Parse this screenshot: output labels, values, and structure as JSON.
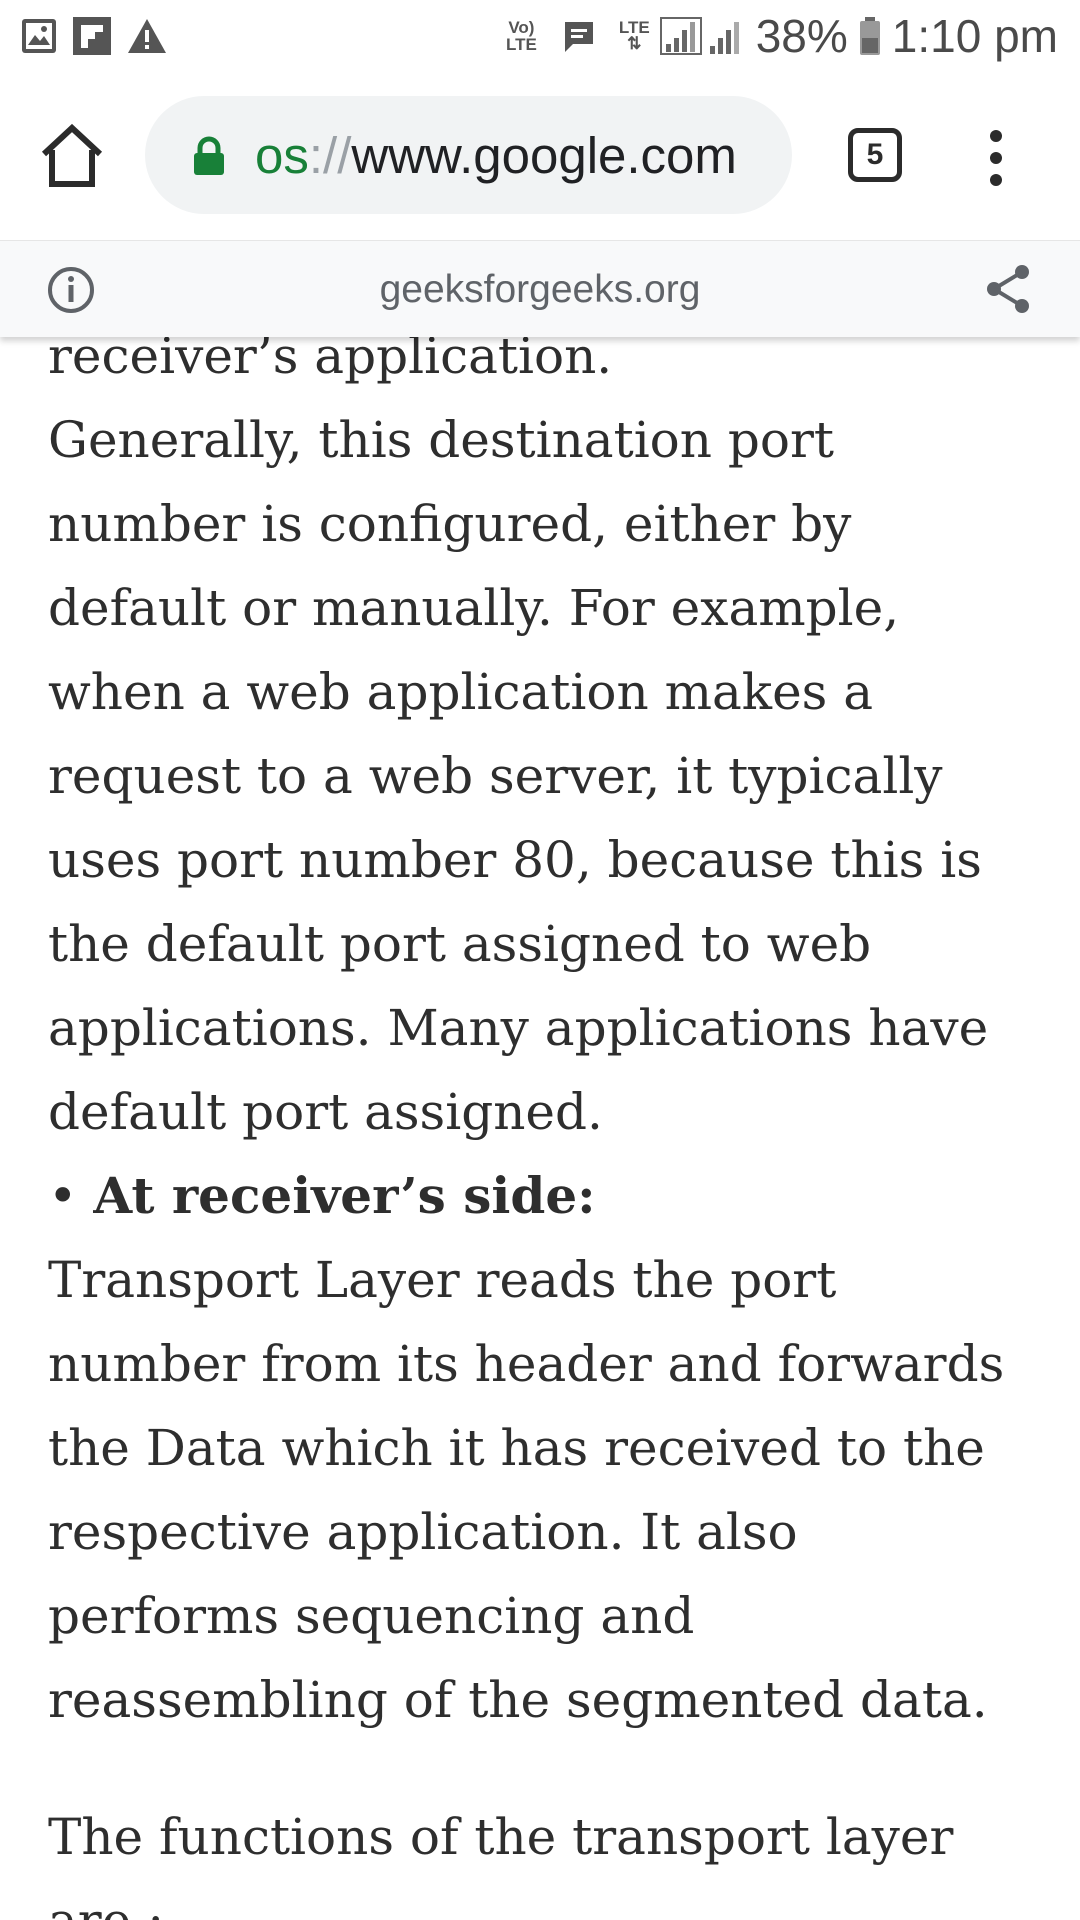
{
  "status_bar": {
    "volte_top": "Vo)",
    "volte_bottom": "LTE",
    "lte_label": "LTE",
    "battery_percent": "38%",
    "time": "1:10 pm",
    "icons": [
      "image-icon",
      "flipboard-icon",
      "warning-icon",
      "message-icon",
      "signal-icon",
      "battery-icon"
    ]
  },
  "browser": {
    "url_scheme_partial": "os",
    "url_separator": "://",
    "url_host": "www.google.com",
    "tab_count": "5",
    "info_domain": "geeksforgeeks.org"
  },
  "article": {
    "lines": [
      "receiver’s application.",
      "Generally, this destination port",
      "number is configured, either by",
      "default or manually. For example,",
      "when a web application makes a",
      "request to a web server, it typically",
      "uses port number 80, because this is",
      "the default port assigned to web",
      "applications. Many applications have",
      "default port assigned."
    ],
    "bullet": "•",
    "bullet_heading": "At receiver’s side:",
    "lines2": [
      "Transport Layer reads the port",
      "number from its header and forwards",
      "the Data which it has received to the",
      "respective application. It also",
      "performs sequencing and",
      "reassembling of the segmented data."
    ],
    "lines3": [
      "The functions of the transport layer",
      "are :"
    ]
  },
  "colors": {
    "secure_green": "#188038",
    "text_dark": "#2e2e2e",
    "pill_bg": "#f1f3f4",
    "info_bg": "#f8f9fa"
  }
}
